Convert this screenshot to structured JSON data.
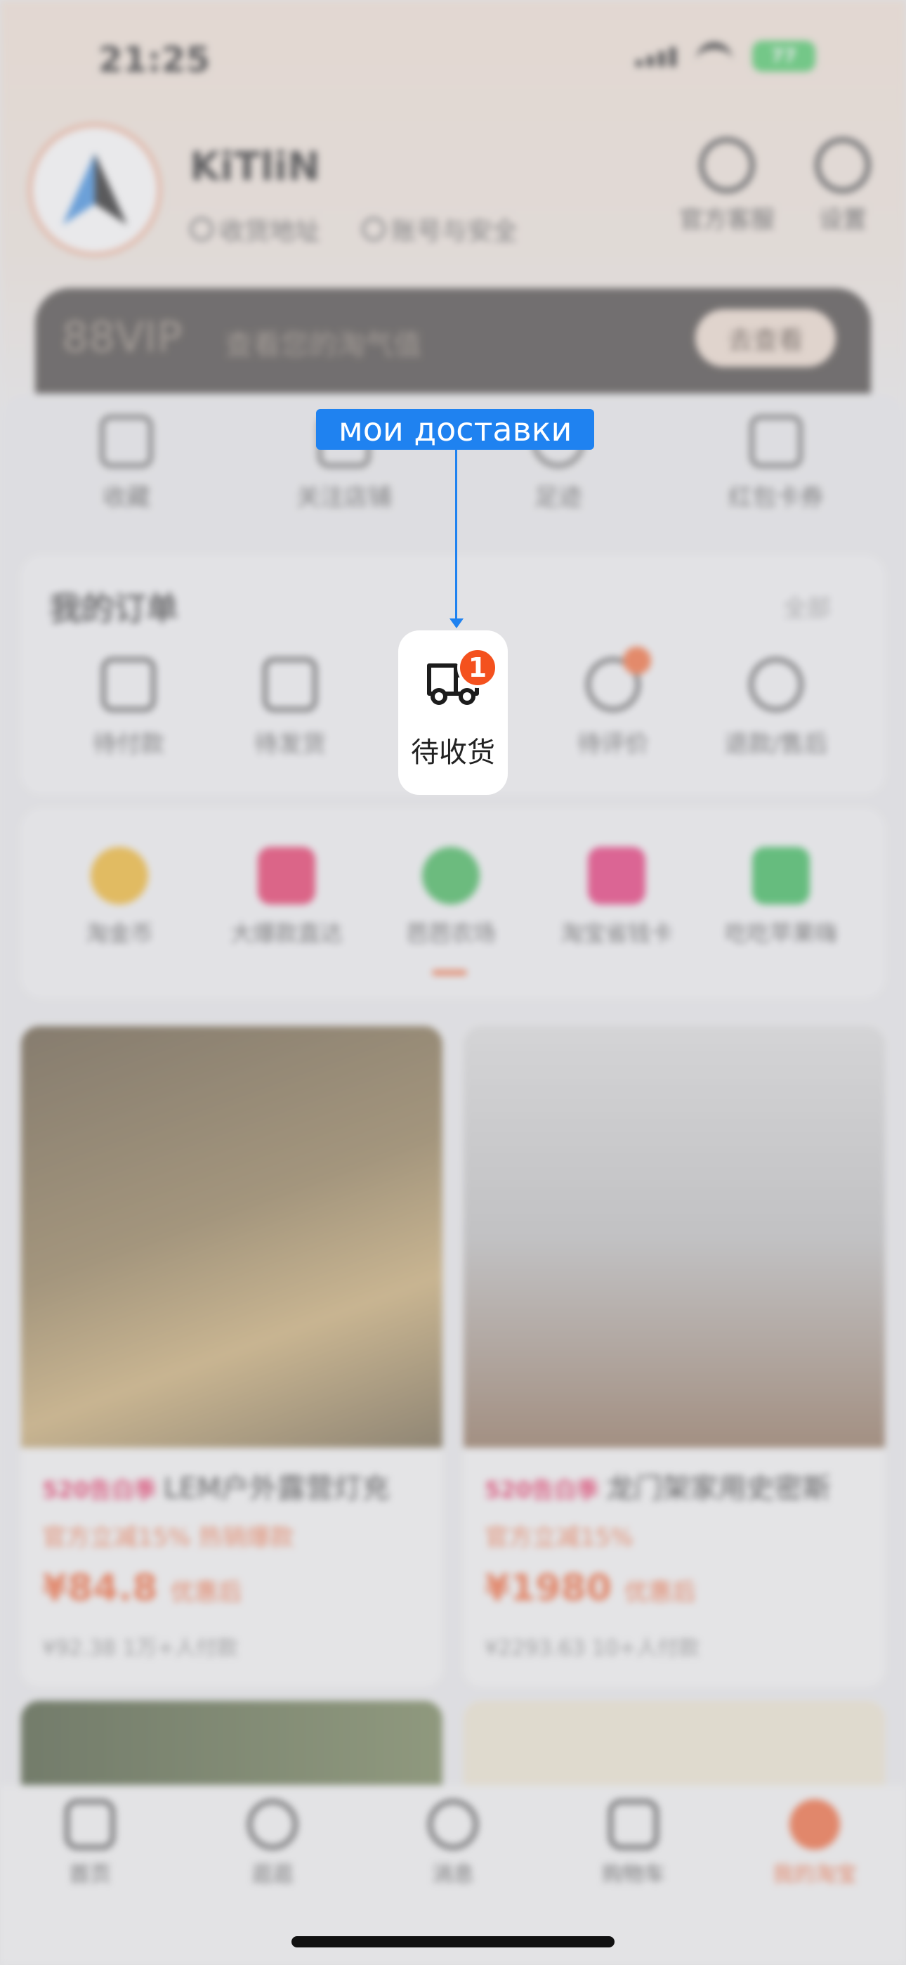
{
  "status_bar": {
    "time": "21:25",
    "battery": "77"
  },
  "profile": {
    "username": "KiTliN",
    "links": [
      "收货地址",
      "账号与安全"
    ]
  },
  "header_buttons": [
    "官方客服",
    "设置"
  ],
  "vip": {
    "title": "88VIP",
    "subtitle": "查看您的淘气值",
    "button": "去查看"
  },
  "quick_links": [
    "收藏",
    "关注店铺",
    "足迹",
    "红包卡券"
  ],
  "orders": {
    "title": "我的订单",
    "all": "全部",
    "items": [
      "待付款",
      "待发货",
      "待收货",
      "待评价",
      "退款/售后"
    ]
  },
  "services": [
    "淘金币",
    "大爆款直达",
    "芭芭农场",
    "淘宝省钱卡",
    "吃吃苹果嗨"
  ],
  "products": [
    {
      "tag": "520告白季",
      "title": "LEM户外露营灯充",
      "discount": "官方立减15%  热销爆款",
      "price": "¥84.8",
      "price_suffix": "优惠后",
      "sold": "¥92.38  1万+人付款"
    },
    {
      "tag": "520告白季",
      "title": "龙门架家用史密斯",
      "discount": "官方立减15%",
      "price": "¥1980",
      "price_suffix": "优惠后",
      "sold": "¥2293.63  10+人付款"
    }
  ],
  "tabbar": [
    "首页",
    "逛逛",
    "消息",
    "购物车",
    "我的淘宝"
  ],
  "highlight": {
    "label": "待收货",
    "badge": "1"
  },
  "callout": {
    "text": "мои доставки"
  },
  "colors": {
    "accent": "#1f82f0",
    "badge": "#f4511e",
    "brand": "#f25c2a"
  }
}
